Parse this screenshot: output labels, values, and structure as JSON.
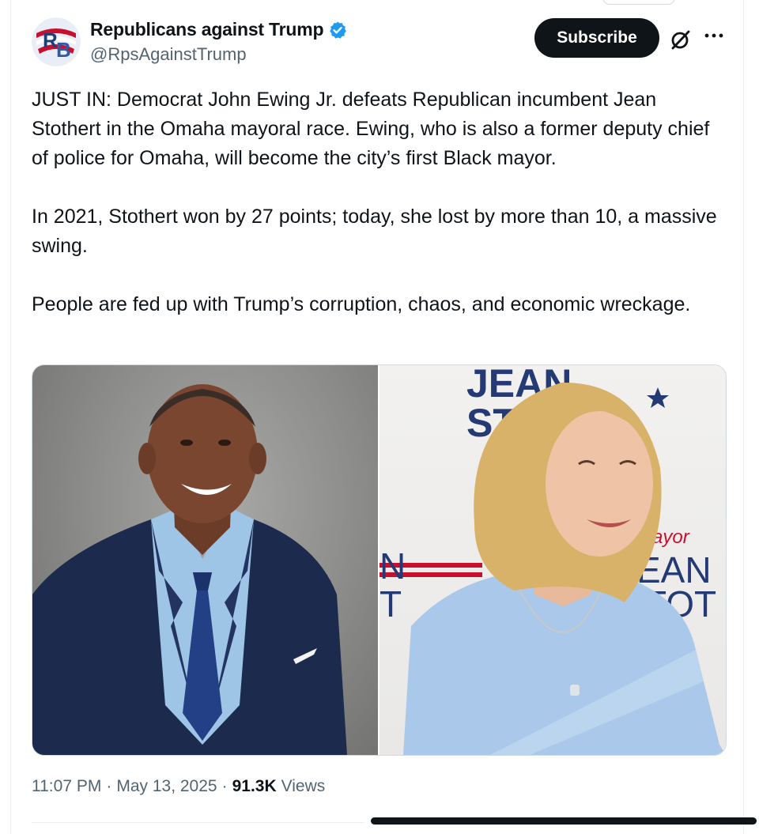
{
  "author": {
    "display_name": "Republicans against Trump",
    "handle": "@RpsAgainstTrump",
    "verified": true,
    "avatar_letters": "RB"
  },
  "actions": {
    "subscribe_label": "Subscribe",
    "grok_icon": "grok-icon",
    "more_icon": "more-options-icon"
  },
  "tweet": {
    "paragraphs": [
      "JUST IN: Democrat John Ewing Jr. defeats Republican incumbent Jean Stothert in the Omaha mayoral race. Ewing, who is also a former deputy chief of police for Omaha, will become the city’s first Black mayor.",
      "In 2021, Stothert won by 27 points; today, she lost by more than 10, a massive swing.",
      "People are fed up with Trump’s corruption, chaos, and economic wreckage."
    ]
  },
  "media": {
    "right_sign_text_1": "JEAN",
    "right_sign_text_2": "STOT",
    "right_sign_mayor": "ayor"
  },
  "meta": {
    "time": "11:07 PM",
    "separator": "·",
    "date": "May 13, 2025",
    "views_count": "91.3K",
    "views_label": "Views"
  },
  "colors": {
    "verified_blue": "#1d9bf0",
    "subscribe_bg": "#0f1419",
    "secondary_text": "#536471"
  }
}
